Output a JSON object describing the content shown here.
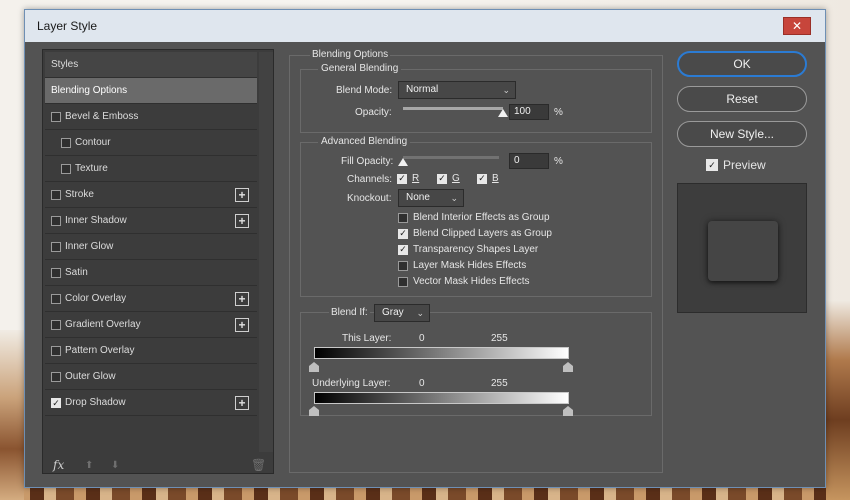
{
  "window": {
    "title": "Layer Style",
    "close": "✕"
  },
  "styles_panel": {
    "items": [
      {
        "label": "Styles",
        "checkbox": false,
        "checked": false,
        "plus": false,
        "indent": false
      },
      {
        "label": "Blending Options",
        "checkbox": false,
        "checked": false,
        "plus": false,
        "indent": false,
        "selected": true
      },
      {
        "label": "Bevel & Emboss",
        "checkbox": true,
        "checked": false,
        "plus": false,
        "indent": false
      },
      {
        "label": "Contour",
        "checkbox": true,
        "checked": false,
        "plus": false,
        "indent": true
      },
      {
        "label": "Texture",
        "checkbox": true,
        "checked": false,
        "plus": false,
        "indent": true
      },
      {
        "label": "Stroke",
        "checkbox": true,
        "checked": false,
        "plus": true,
        "indent": false
      },
      {
        "label": "Inner Shadow",
        "checkbox": true,
        "checked": false,
        "plus": true,
        "indent": false
      },
      {
        "label": "Inner Glow",
        "checkbox": true,
        "checked": false,
        "plus": false,
        "indent": false
      },
      {
        "label": "Satin",
        "checkbox": true,
        "checked": false,
        "plus": false,
        "indent": false
      },
      {
        "label": "Color Overlay",
        "checkbox": true,
        "checked": false,
        "plus": true,
        "indent": false
      },
      {
        "label": "Gradient Overlay",
        "checkbox": true,
        "checked": false,
        "plus": true,
        "indent": false
      },
      {
        "label": "Pattern Overlay",
        "checkbox": true,
        "checked": false,
        "plus": false,
        "indent": false
      },
      {
        "label": "Outer Glow",
        "checkbox": true,
        "checked": false,
        "plus": false,
        "indent": false
      },
      {
        "label": "Drop Shadow",
        "checkbox": true,
        "checked": true,
        "plus": true,
        "indent": false
      }
    ],
    "footer": {
      "fx": "fx",
      "up": "⬆",
      "down": "⬇",
      "trash": "🗑"
    }
  },
  "blending": {
    "group_title": "Blending Options",
    "general": {
      "title": "General Blending",
      "blend_mode_label": "Blend Mode:",
      "blend_mode_value": "Normal",
      "opacity_label": "Opacity:",
      "opacity_value": "100",
      "opacity_unit": "%",
      "opacity_level": 1.0
    },
    "advanced": {
      "title": "Advanced Blending",
      "fill_opacity_label": "Fill Opacity:",
      "fill_opacity_value": "0",
      "fill_opacity_unit": "%",
      "fill_opacity_level": 0.0,
      "channels_label": "Channels:",
      "channels": [
        {
          "label": "R",
          "checked": true
        },
        {
          "label": "G",
          "checked": true
        },
        {
          "label": "B",
          "checked": true
        }
      ],
      "knockout_label": "Knockout:",
      "knockout_value": "None",
      "options": [
        {
          "label": "Blend Interior Effects as Group",
          "checked": false
        },
        {
          "label": "Blend Clipped Layers as Group",
          "checked": true
        },
        {
          "label": "Transparency Shapes Layer",
          "checked": true
        },
        {
          "label": "Layer Mask Hides Effects",
          "checked": false
        },
        {
          "label": "Vector Mask Hides Effects",
          "checked": false
        }
      ]
    },
    "blend_if": {
      "label": "Blend If:",
      "value": "Gray",
      "this_layer_label": "This Layer:",
      "this_layer_min": "0",
      "this_layer_max": "255",
      "underlying_label": "Underlying Layer:",
      "underlying_min": "0",
      "underlying_max": "255"
    }
  },
  "buttons": {
    "ok": "OK",
    "reset": "Reset",
    "new_style": "New Style...",
    "preview_label": "Preview",
    "preview_checked": true
  },
  "icons": {
    "chevron": "chevron-down-icon",
    "check": "checkmark-icon",
    "plus": "plus-icon"
  }
}
